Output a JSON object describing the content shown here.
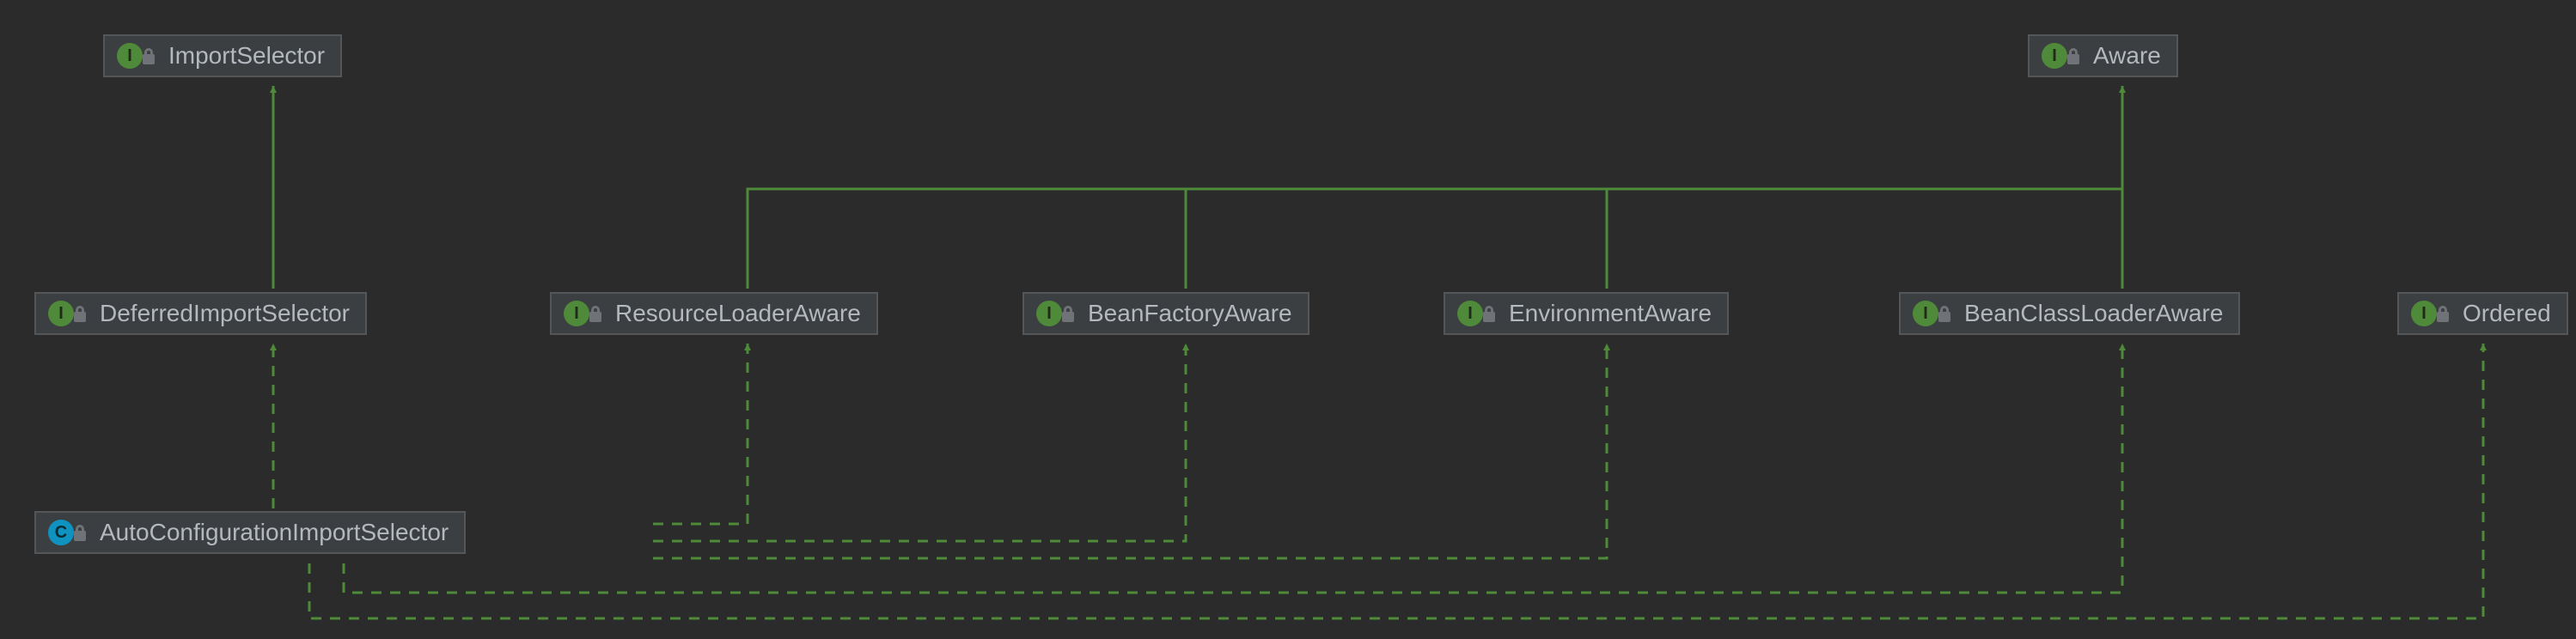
{
  "nodes": {
    "import_selector": {
      "label": "ImportSelector",
      "kind": "interface"
    },
    "aware": {
      "label": "Aware",
      "kind": "interface"
    },
    "deferred_import_selector": {
      "label": "DeferredImportSelector",
      "kind": "interface"
    },
    "resource_loader_aware": {
      "label": "ResourceLoaderAware",
      "kind": "interface"
    },
    "bean_factory_aware": {
      "label": "BeanFactoryAware",
      "kind": "interface"
    },
    "environment_aware": {
      "label": "EnvironmentAware",
      "kind": "interface"
    },
    "bean_class_loader_aware": {
      "label": "BeanClassLoaderAware",
      "kind": "interface"
    },
    "ordered": {
      "label": "Ordered",
      "kind": "interface"
    },
    "auto_configuration_import_selector": {
      "label": "AutoConfigurationImportSelector",
      "kind": "class"
    }
  },
  "edges": [
    {
      "from": "deferred_import_selector",
      "to": "import_selector",
      "style": "extends"
    },
    {
      "from": "resource_loader_aware",
      "to": "aware",
      "style": "extends"
    },
    {
      "from": "bean_factory_aware",
      "to": "aware",
      "style": "extends"
    },
    {
      "from": "bean_class_loader_aware",
      "to": "aware",
      "style": "extends"
    },
    {
      "from": "environment_aware",
      "to": "aware",
      "style": "extends"
    },
    {
      "from": "auto_configuration_import_selector",
      "to": "deferred_import_selector",
      "style": "implements"
    },
    {
      "from": "auto_configuration_import_selector",
      "to": "resource_loader_aware",
      "style": "implements"
    },
    {
      "from": "auto_configuration_import_selector",
      "to": "bean_factory_aware",
      "style": "implements"
    },
    {
      "from": "auto_configuration_import_selector",
      "to": "environment_aware",
      "style": "implements"
    },
    {
      "from": "auto_configuration_import_selector",
      "to": "bean_class_loader_aware",
      "style": "implements"
    },
    {
      "from": "auto_configuration_import_selector",
      "to": "ordered",
      "style": "implements"
    }
  ],
  "glyphs": {
    "interface": "I",
    "class": "C"
  }
}
